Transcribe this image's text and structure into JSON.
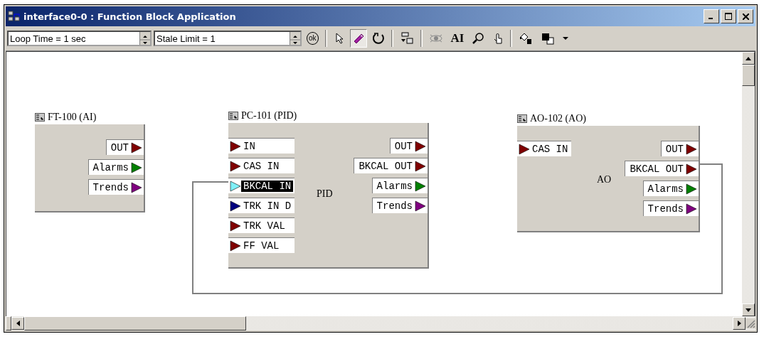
{
  "window": {
    "title": "interface0-0 : Function Block Application"
  },
  "toolbar": {
    "fields": [
      {
        "value": "Loop Time = 1 sec"
      },
      {
        "value": "Stale Limit = 1"
      }
    ],
    "tools": [
      {
        "kind": "ok",
        "label": "ok",
        "selected": false
      },
      {
        "kind": "sep"
      },
      {
        "kind": "pointer",
        "selected": false
      },
      {
        "kind": "connect",
        "selected": true
      },
      {
        "kind": "loop",
        "selected": false
      },
      {
        "kind": "sep"
      },
      {
        "kind": "blocks",
        "selected": false
      },
      {
        "kind": "sep"
      },
      {
        "kind": "eye",
        "selected": false
      },
      {
        "kind": "text",
        "label": "AI",
        "selected": false
      },
      {
        "kind": "zoom",
        "selected": false
      },
      {
        "kind": "hand",
        "selected": false
      },
      {
        "kind": "sep"
      },
      {
        "kind": "fill",
        "selected": false
      },
      {
        "kind": "colors",
        "selected": false
      },
      {
        "kind": "dropdown",
        "selected": false
      }
    ]
  },
  "blocks": [
    {
      "title": "FT-100 (AI)",
      "outputs": [
        {
          "label": "OUT",
          "color": "#800000",
          "selected": false
        },
        {
          "label": "Alarms",
          "color": "#008000",
          "selected": false
        },
        {
          "label": "Trends",
          "color": "#800080",
          "selected": false
        }
      ]
    },
    {
      "title": "PC-101 (PID)",
      "type_label": "PID",
      "inputs": [
        {
          "label": "IN",
          "color": "#800000",
          "selected": false
        },
        {
          "label": "CAS IN",
          "color": "#800000",
          "selected": false
        },
        {
          "label": "BKCAL IN",
          "color": "#7ff0f8",
          "selected": true
        },
        {
          "label": "TRK IN D",
          "color": "#000080",
          "selected": false
        },
        {
          "label": "TRK VAL",
          "color": "#800000",
          "selected": false
        },
        {
          "label": "FF VAL",
          "color": "#800000",
          "selected": false
        }
      ],
      "outputs": [
        {
          "label": "OUT",
          "color": "#800000",
          "selected": false
        },
        {
          "label": "BKCAL OUT",
          "color": "#800000",
          "selected": false
        },
        {
          "label": "Alarms",
          "color": "#008000",
          "selected": false
        },
        {
          "label": "Trends",
          "color": "#800080",
          "selected": false
        }
      ]
    },
    {
      "title": "AO-102 (AO)",
      "type_label": "AO",
      "inputs": [
        {
          "label": "CAS IN",
          "color": "#800000",
          "selected": false
        }
      ],
      "outputs": [
        {
          "label": "OUT",
          "color": "#800000",
          "selected": false
        },
        {
          "label": "BKCAL OUT",
          "color": "#800000",
          "selected": false
        },
        {
          "label": "Alarms",
          "color": "#008000",
          "selected": false
        },
        {
          "label": "Trends",
          "color": "#800080",
          "selected": false
        }
      ]
    }
  ]
}
